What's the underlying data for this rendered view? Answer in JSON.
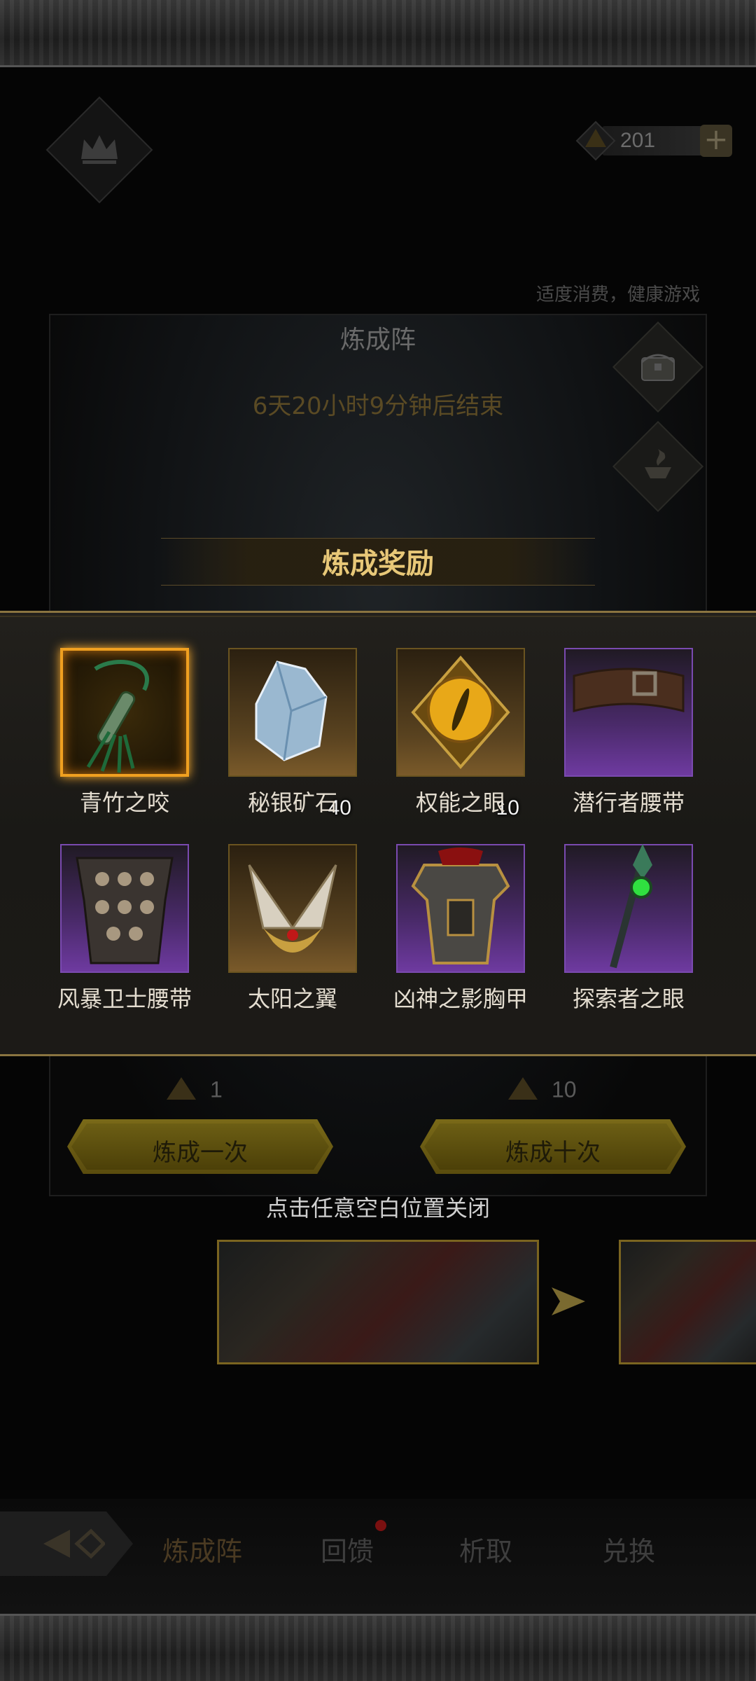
{
  "top_bar": {
    "currency_value": "201",
    "notice": "适度消费，健康游戏"
  },
  "panel": {
    "title": "炼成阵",
    "timer": "6天20小时9分钟后结束"
  },
  "reward": {
    "title": "炼成奖励",
    "items": [
      {
        "name": "青竹之咬",
        "count": "",
        "rarity": "legend"
      },
      {
        "name": "秘银矿石",
        "count": "40",
        "rarity": "gold"
      },
      {
        "name": "权能之眼",
        "count": "10",
        "rarity": "gold"
      },
      {
        "name": "潜行者腰带",
        "count": "",
        "rarity": "purple"
      },
      {
        "name": "风暴卫士腰带",
        "count": "",
        "rarity": "purple"
      },
      {
        "name": "太阳之翼",
        "count": "",
        "rarity": "gold"
      },
      {
        "name": "凶神之影胸甲",
        "count": "",
        "rarity": "purple"
      },
      {
        "name": "探索者之眼",
        "count": "",
        "rarity": "purple"
      }
    ]
  },
  "craft": {
    "once_cost": "1",
    "ten_cost": "10",
    "once_label": "炼成一次",
    "ten_label": "炼成十次"
  },
  "close_hint": "点击任意空白位置关闭",
  "nav": {
    "tabs": [
      "炼成阵",
      "回馈",
      "析取",
      "兑换"
    ]
  },
  "colors": {
    "accent_gold": "#e8c878",
    "legend_orange": "#f0a020",
    "epic_purple": "#6e3aa0"
  }
}
